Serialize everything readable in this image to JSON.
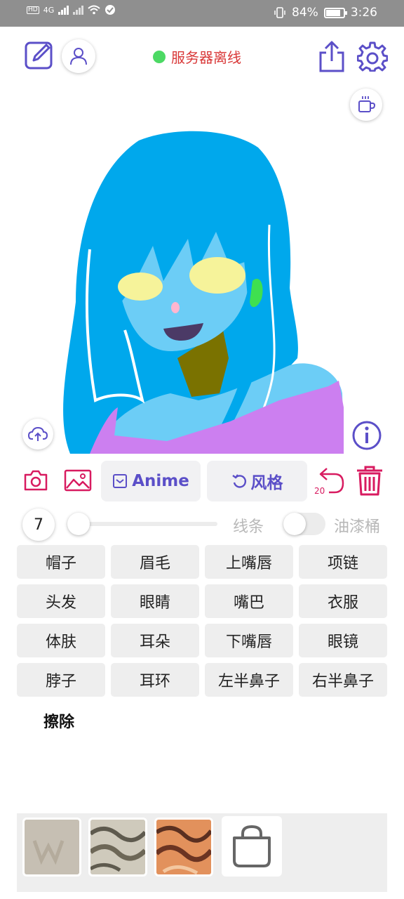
{
  "status_bar": {
    "left_badge": "HD",
    "net_label": "4G",
    "battery": "84%",
    "battery_level": 0.84,
    "time": "3:26"
  },
  "header": {
    "server_status_text": "服务器离线",
    "server_status_color": "#4cd964"
  },
  "toolbar": {
    "anime_label": "Anime",
    "style_label": "风格",
    "undo_count": "20"
  },
  "brush": {
    "size": "7",
    "slider_level": 0.0,
    "lines_label": "线条",
    "bucket_label": "油漆桶",
    "bucket_enabled": false
  },
  "labels": [
    "帽子",
    "眉毛",
    "上嘴唇",
    "项链",
    "头发",
    "眼睛",
    "嘴巴",
    "衣服",
    "体肤",
    "耳朵",
    "下嘴唇",
    "眼镜",
    "脖子",
    "耳环",
    "左半鼻子",
    "右半鼻子"
  ],
  "erase_label": "擦除",
  "colors": {
    "accent_purple": "#5b4fc8",
    "accent_red": "#d81b60",
    "status_text": "#d93838"
  },
  "icons": [
    "edit-icon",
    "user-icon",
    "share-icon",
    "gear-icon",
    "coffee-icon",
    "cloud-upload-icon",
    "info-icon",
    "camera-icon",
    "image-icon",
    "frame-icon",
    "refresh-icon",
    "undo-icon",
    "trash-icon",
    "shopping-bag-icon"
  ]
}
